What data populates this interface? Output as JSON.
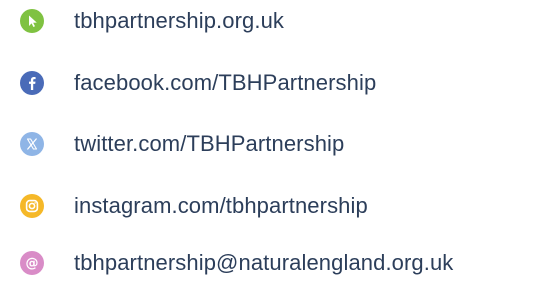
{
  "contacts": [
    {
      "label": "tbhpartnership.org.uk",
      "icon": "cursor-arrow-icon",
      "color": "#7fc241"
    },
    {
      "label": "facebook.com/TBHPartnership",
      "icon": "facebook-icon",
      "color": "#4a6bb8"
    },
    {
      "label": "twitter.com/TBHPartnership",
      "icon": "x-twitter-icon",
      "color": "#8fb5e6"
    },
    {
      "label": "instagram.com/tbhpartnership",
      "icon": "instagram-icon",
      "color": "#f5b828"
    },
    {
      "label": "tbhpartnership@naturalengland.org.uk",
      "icon": "at-sign-icon",
      "color": "#d98cc7"
    }
  ]
}
